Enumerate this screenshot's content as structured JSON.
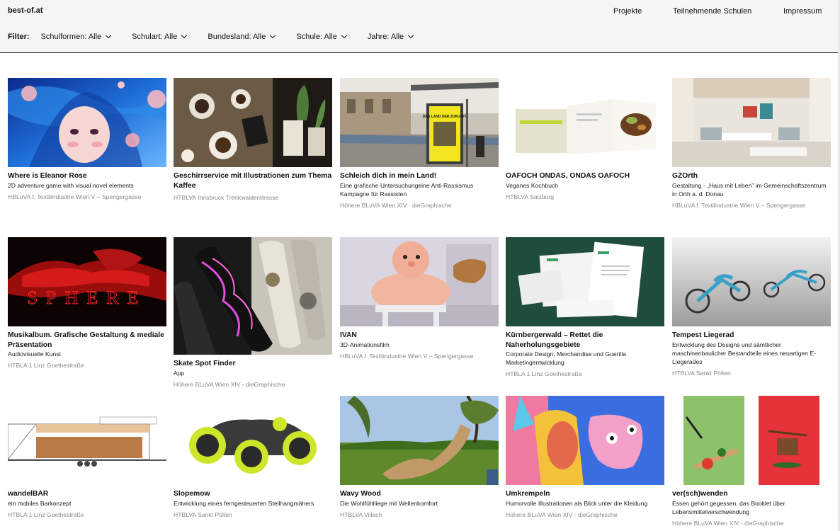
{
  "header": {
    "logo": "best-of.at",
    "nav": [
      "Projekte",
      "Teilnehmende Schulen",
      "Impressum"
    ]
  },
  "filters": {
    "label": "Filter:",
    "items": [
      "Schulformen: Alle",
      "Schulart: Alle",
      "Bundesland: Alle",
      "Schule: Alle",
      "Jahre: Alle"
    ]
  },
  "projects": [
    {
      "title": "Where is Eleanor Rose",
      "subtitle": "2D adventure game with visual novel elements",
      "school": "HBLuVA f. Textilindustrie Wien V – Spengergasse"
    },
    {
      "title": "Geschirrservice mit Illustrationen zum Thema Kaffee",
      "subtitle": "",
      "school": "HTBLVA Innsbruck Trenkwalderstrasse"
    },
    {
      "title": "Schleich dich in mein Land!",
      "subtitle": "Eine grafische Untersuchungeine Anti-Rassismus Kampagne für Rassisten",
      "school": "Höhere BLuVA Wien XIV - dieGraphische"
    },
    {
      "title": "OAFOCH ONDAS, ONDAS OAFOCH",
      "subtitle": "Veganes Kochbuch",
      "school": "HTBLVA Salzburg"
    },
    {
      "title": "GZOrth",
      "subtitle": "Gestaltung - „Haus mit Leben\" im Gemeinschaftszentrum in Orth a. d. Donau",
      "school": "HBLuVA f. Textilindustrie Wien V – Spengergasse"
    },
    {
      "title": "Musikalbum. Grafische Gestaltung & mediale Präsentation",
      "subtitle": "Audiovisuelle Kunst",
      "school": "HTBLA 1 Linz Goethestraße"
    },
    {
      "title": "Skate Spot Finder",
      "subtitle": "App",
      "school": "Höhere BLuVA Wien XIV - dieGraphische"
    },
    {
      "title": "IVAN",
      "subtitle": "3D-Animationsfilm",
      "school": "HBLuVA f. Textilindustrie Wien V – Spengergasse"
    },
    {
      "title": "Kürnbergerwald – Rettet die Naherholungsgebiete",
      "subtitle": "Corporate Design, Merchandise und Guerilla Marketingentwicklung",
      "school": "HTBLA 1 Linz Goethestraße"
    },
    {
      "title": "Tempest Liegerad",
      "subtitle": "Entwicklung des Designs und sämtlicher maschinenbaulicher Bestandteile eines neuartigen E-Liegerades",
      "school": "HTBLVA Sankt Pölten"
    },
    {
      "title": "wandelBAR",
      "subtitle": "ein mobiles Barkonzept",
      "school": "HTBLA 1 Linz Goethestraße"
    },
    {
      "title": "Slopemow",
      "subtitle": "Entwicklung eines ferngesteuerten Steilhangmähers",
      "school": "HTBLVA Sankt Pölten"
    },
    {
      "title": "Wavy Wood",
      "subtitle": "Die Wohlfühlliege mit Wellenkomfort",
      "school": "HTBLVA Villach"
    },
    {
      "title": "Umkrempeln",
      "subtitle": "Humorvolle Illustrationen als Blick unter die Kleidung",
      "school": "Höhere BLuVA Wien XIV - dieGraphische"
    },
    {
      "title": "ver(sch)wenden",
      "subtitle": "Essen gehört gegessen, das Booklet über Lebensmittelverschwendung",
      "school": "Höhere BLuVA Wien XIV - dieGraphische"
    }
  ],
  "sign_text": {
    "poster_headline": "DAS LAND DER ZUKUNFT",
    "sphere": "SPHERE"
  }
}
